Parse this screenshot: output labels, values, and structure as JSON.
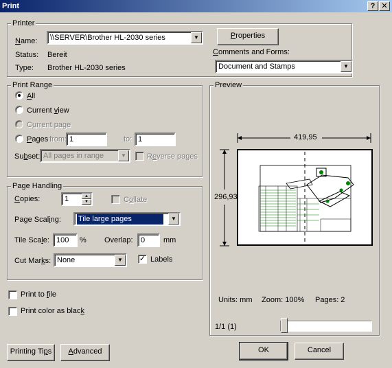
{
  "window": {
    "title": "Print",
    "help_glyph": "?",
    "close_glyph": "✕"
  },
  "printer": {
    "group_label": "Printer",
    "name_label": "Name:",
    "name_value": "\\\\SERVER\\Brother HL-2030 series",
    "status_label": "Status:",
    "status_value": "Bereit",
    "type_label": "Type:",
    "type_value": "Brother HL-2030 series",
    "properties_button": "Properties",
    "comments_label": "Comments and Forms:",
    "comments_value": "Document and Stamps"
  },
  "print_range": {
    "group_label": "Print Range",
    "all": "All",
    "current_view": "Current view",
    "current_page": "Current page",
    "pages": "Pages",
    "from_label": "from:",
    "from_value": "1",
    "to_label": "to:",
    "to_value": "1",
    "subset_label": "Subset:",
    "subset_value": "All pages in range",
    "reverse_pages": "Reverse pages",
    "selected": "all"
  },
  "page_handling": {
    "group_label": "Page Handling",
    "copies_label": "Copies:",
    "copies_value": "1",
    "collate": "Collate",
    "scaling_label": "Page Scaling:",
    "scaling_value": "Tile large pages",
    "tile_scale_label": "Tile Scale:",
    "tile_scale_value": "100",
    "tile_scale_unit": "%",
    "overlap_label": "Overlap:",
    "overlap_value": "0",
    "overlap_unit": "mm",
    "cut_marks_label": "Cut Marks:",
    "cut_marks_value": "None",
    "labels": "Labels",
    "labels_checked": true
  },
  "options": {
    "print_to_file": "Print to file",
    "print_color_black": "Print color as black"
  },
  "preview": {
    "group_label": "Preview",
    "width_value": "419,95",
    "height_value": "296,93",
    "units_text": "Units: mm",
    "zoom_text": "Zoom: 100%",
    "pages_text": "Pages: 2",
    "page_indicator": "1/1 (1)"
  },
  "buttons": {
    "printing_tips": "Printing Tips",
    "advanced": "Advanced",
    "ok": "OK",
    "cancel": "Cancel"
  },
  "colors": {
    "title_bar": "#0a246a",
    "dialog_bg": "#d4d0c8",
    "selection": "#0a246a",
    "drawing_accent": "#008000"
  },
  "icons": {
    "dropdown": "chevron-down-icon",
    "radio_selected": "radio-dot-icon",
    "checkmark": "checkmark-icon"
  }
}
